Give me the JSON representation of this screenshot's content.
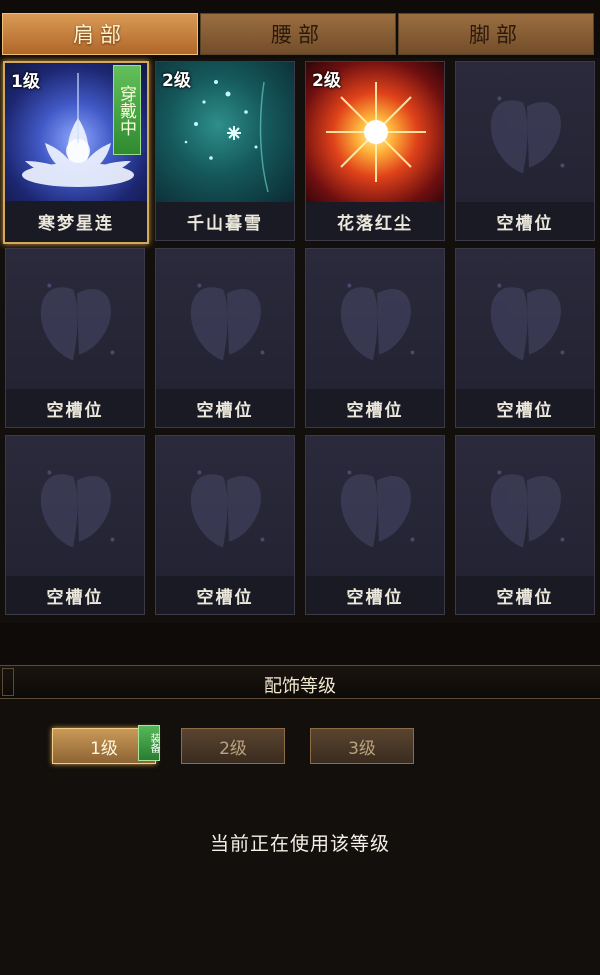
{
  "tabs": [
    {
      "label": "肩部",
      "active": true
    },
    {
      "label": "腰部",
      "active": false
    },
    {
      "label": "脚部",
      "active": false
    }
  ],
  "slots": [
    {
      "level": "1级",
      "name": "寒梦星连",
      "badge": "穿戴中",
      "art": "lotus",
      "selected": true
    },
    {
      "level": "2级",
      "name": "千山暮雪",
      "art": "snow"
    },
    {
      "level": "2级",
      "name": "花落红尘",
      "art": "fire"
    },
    {
      "name": "空槽位",
      "art": "empty"
    },
    {
      "name": "空槽位",
      "art": "empty"
    },
    {
      "name": "空槽位",
      "art": "empty"
    },
    {
      "name": "空槽位",
      "art": "empty"
    },
    {
      "name": "空槽位",
      "art": "empty"
    },
    {
      "name": "空槽位",
      "art": "empty"
    },
    {
      "name": "空槽位",
      "art": "empty"
    },
    {
      "name": "空槽位",
      "art": "empty"
    },
    {
      "name": "空槽位",
      "art": "empty"
    }
  ],
  "section": {
    "title": "配饰等级"
  },
  "levels": [
    {
      "label": "1级",
      "active": true,
      "tag": "装备"
    },
    {
      "label": "2级",
      "active": false
    },
    {
      "label": "3级",
      "active": false
    }
  ],
  "status": "当前正在使用该等级",
  "colors": {
    "tab_active": "#c9853f",
    "badge_green": "#3e9a3c",
    "slot_bg": "#20202b",
    "selected_border": "#d3aa5c"
  },
  "icons": [
    "butterfly-icon",
    "lotus-icon",
    "snowflake-icon",
    "flare-icon"
  ]
}
